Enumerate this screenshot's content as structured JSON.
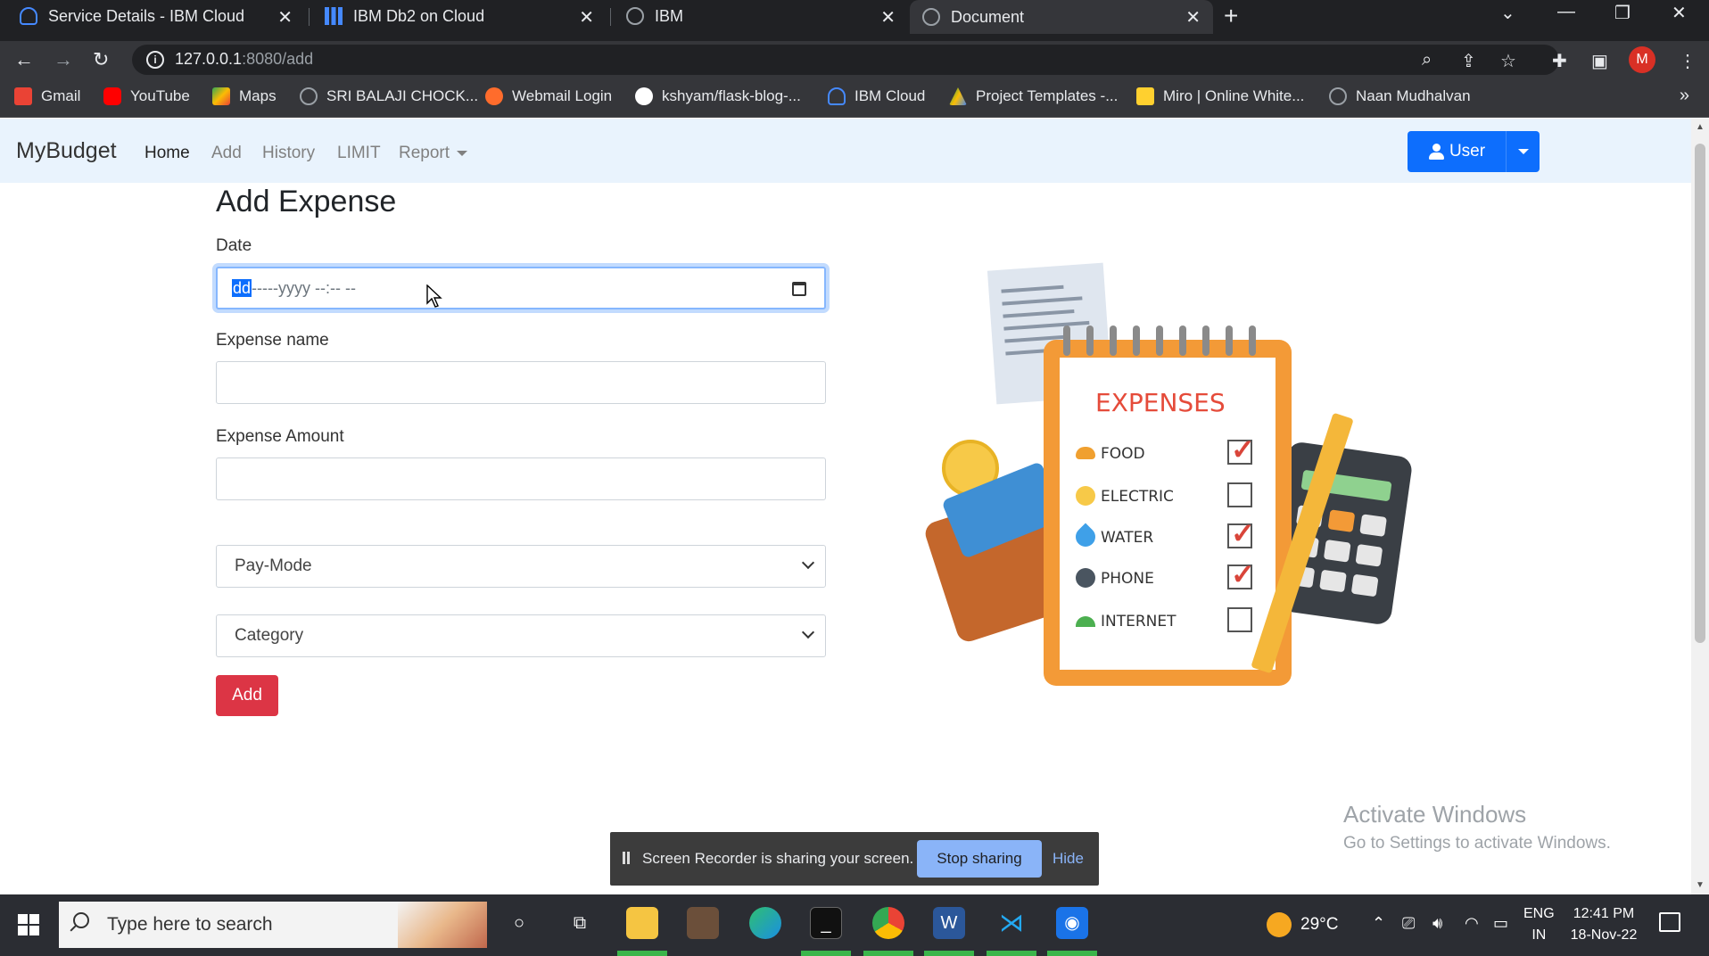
{
  "browser": {
    "tabs": [
      {
        "title": "Service Details - IBM Cloud",
        "icon": "ibm-cloud-icon"
      },
      {
        "title": "IBM Db2 on Cloud",
        "icon": "db2-chart-icon"
      },
      {
        "title": "IBM",
        "icon": "globe-icon"
      },
      {
        "title": "Document",
        "icon": "globe-icon",
        "active": true
      }
    ],
    "url_host": "127.0.0.1",
    "url_rest": ":8080/add",
    "profile_initial": "M",
    "bookmarks": [
      {
        "label": "Gmail",
        "icon": "gmail-icon",
        "color": "#ea4335"
      },
      {
        "label": "YouTube",
        "icon": "youtube-icon",
        "color": "#ff0000"
      },
      {
        "label": "Maps",
        "icon": "maps-icon",
        "color": "#34a853"
      },
      {
        "label": "SRI BALAJI CHOCK...",
        "icon": "globe-icon",
        "color": "#9aa0a6"
      },
      {
        "label": "Webmail Login",
        "icon": "cpanel-icon",
        "color": "#ff6c2c"
      },
      {
        "label": "kshyam/flask-blog-...",
        "icon": "github-icon",
        "color": "#ffffff"
      },
      {
        "label": "IBM Cloud",
        "icon": "ibm-cloud-icon",
        "color": "#4589ff"
      },
      {
        "label": "Project Templates -...",
        "icon": "drive-icon",
        "color": "#fbbc04"
      },
      {
        "label": "Miro | Online White...",
        "icon": "miro-icon",
        "color": "#ffd02f"
      },
      {
        "label": "Naan Mudhalvan",
        "icon": "globe-icon",
        "color": "#9aa0a6"
      }
    ]
  },
  "navbar": {
    "brand": "MyBudget",
    "links": [
      {
        "label": "Home",
        "active": true
      },
      {
        "label": "Add",
        "active": false
      },
      {
        "label": "History",
        "active": false
      },
      {
        "label": "LIMIT",
        "active": false
      },
      {
        "label": "Report",
        "active": false,
        "dropdown": true
      }
    ],
    "user_button": "User"
  },
  "form": {
    "title": "Add Expense",
    "date_label": "Date",
    "date_selected": "dd",
    "date_rest": "-----yyyy --:-- --",
    "name_label": "Expense name",
    "name_value": "",
    "amount_label": "Expense Amount",
    "amount_value": "",
    "paymode_selected": "Pay-Mode",
    "category_selected": "Category",
    "submit_label": "Add"
  },
  "illustration": {
    "title": "EXPENSES",
    "items": [
      {
        "label": "FOOD",
        "checked": true,
        "icon": "burger-icon",
        "color": "#f0a030"
      },
      {
        "label": "ELECTRIC",
        "checked": false,
        "icon": "bulb-icon",
        "color": "#f7c948"
      },
      {
        "label": "WATER",
        "checked": true,
        "icon": "water-drop-icon",
        "color": "#3fa0e8"
      },
      {
        "label": "PHONE",
        "checked": true,
        "icon": "phone-icon",
        "color": "#4a5560"
      },
      {
        "label": "INTERNET",
        "checked": false,
        "icon": "wifi-icon",
        "color": "#4caf50"
      }
    ]
  },
  "watermark": {
    "line1": "Activate Windows",
    "line2": "Go to Settings to activate Windows."
  },
  "share_bar": {
    "message": "Screen Recorder is sharing your screen.",
    "stop_label": "Stop sharing",
    "hide_label": "Hide"
  },
  "taskbar": {
    "search_placeholder": "Type here to search",
    "temperature": "29°C",
    "lang_line1": "ENG",
    "lang_line2": "IN",
    "time": "12:41 PM",
    "date": "18-Nov-22"
  }
}
